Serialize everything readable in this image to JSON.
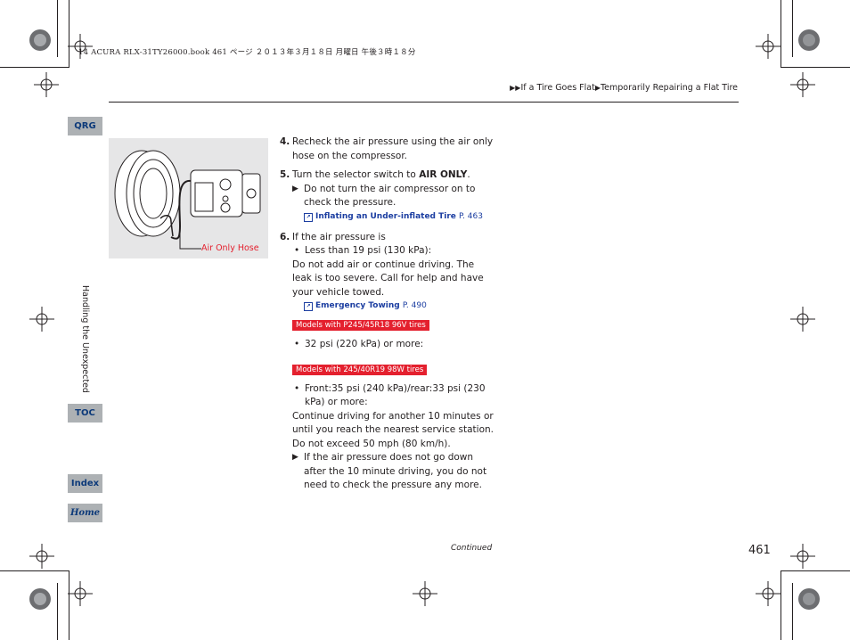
{
  "header": {
    "print_meta": "14 ACURA RLX-31TY26000.book  461 ページ  ２０１３年３月１８日  月曜日  午後３時１８分",
    "breadcrumb": [
      "If a Tire Goes Flat",
      "Temporarily Repairing a Flat Tire"
    ]
  },
  "sidebar": {
    "qrg": "QRG",
    "section": "Handling the Unexpected",
    "toc": "TOC",
    "index": "Index",
    "home": "Home"
  },
  "figure": {
    "callout": "Air Only Hose"
  },
  "steps": {
    "s4": {
      "num": "4.",
      "text": "Recheck the air pressure using the air only hose on the compressor."
    },
    "s5": {
      "num": "5.",
      "text_pre": "Turn the selector switch to ",
      "text_bold": "AIR ONLY",
      "text_post": ".",
      "note": "Do not turn the air compressor on to check the pressure.",
      "xref_label": "Inflating an Under-inflated Tire",
      "xref_page": "P. 463"
    },
    "s6": {
      "num": "6.",
      "text": "If the air pressure is",
      "bullet1": "Less than 19 psi (130 kPa):",
      "para1": "Do not add air or continue driving. The leak is too severe. Call for help and have your vehicle towed.",
      "xref_label": "Emergency Towing",
      "xref_page": "P. 490",
      "tag1": "Models with P245/45R18 96V tires",
      "bullet2": "32 psi (220 kPa) or more:",
      "tag2": "Models with 245/40R19 98W tires",
      "bullet3": "Front:35 psi (240 kPa)/rear:33 psi (230 kPa) or more:",
      "para2": "Continue driving for another 10 minutes or until you reach the nearest service station. Do not exceed 50 mph (80 km/h).",
      "note": "If the air pressure does not go down after the 10 minute driving, you do not need to check the pressure any more."
    }
  },
  "footer": {
    "continued": "Continued",
    "page_number": "461"
  },
  "colors": {
    "accent_red": "#e4202e",
    "link_blue": "#1c3ea1",
    "tab_gray": "#adb1b4"
  }
}
